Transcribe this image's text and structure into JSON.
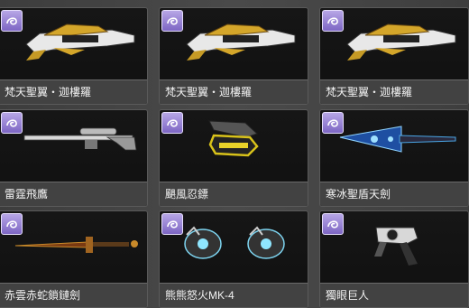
{
  "cards": [
    {
      "name": "梵天聖翼・迦樓羅"
    },
    {
      "name": "梵天聖翼・迦樓羅"
    },
    {
      "name": "梵天聖翼・迦樓羅"
    },
    {
      "name": "雷霆飛鷹"
    },
    {
      "name": "颶風忍鏢"
    },
    {
      "name": "寒冰聖盾天劍"
    },
    {
      "name": "赤雲赤蛇鎖鏈劍"
    },
    {
      "name": "熊熊怒火MK-4"
    },
    {
      "name": "獨眼巨人"
    }
  ],
  "colors": {
    "badge": "#9a86d8",
    "label_bar": "#464646",
    "card_bg": "#121212"
  },
  "icons": {
    "rarity_badge": "purple-swirl-icon"
  }
}
